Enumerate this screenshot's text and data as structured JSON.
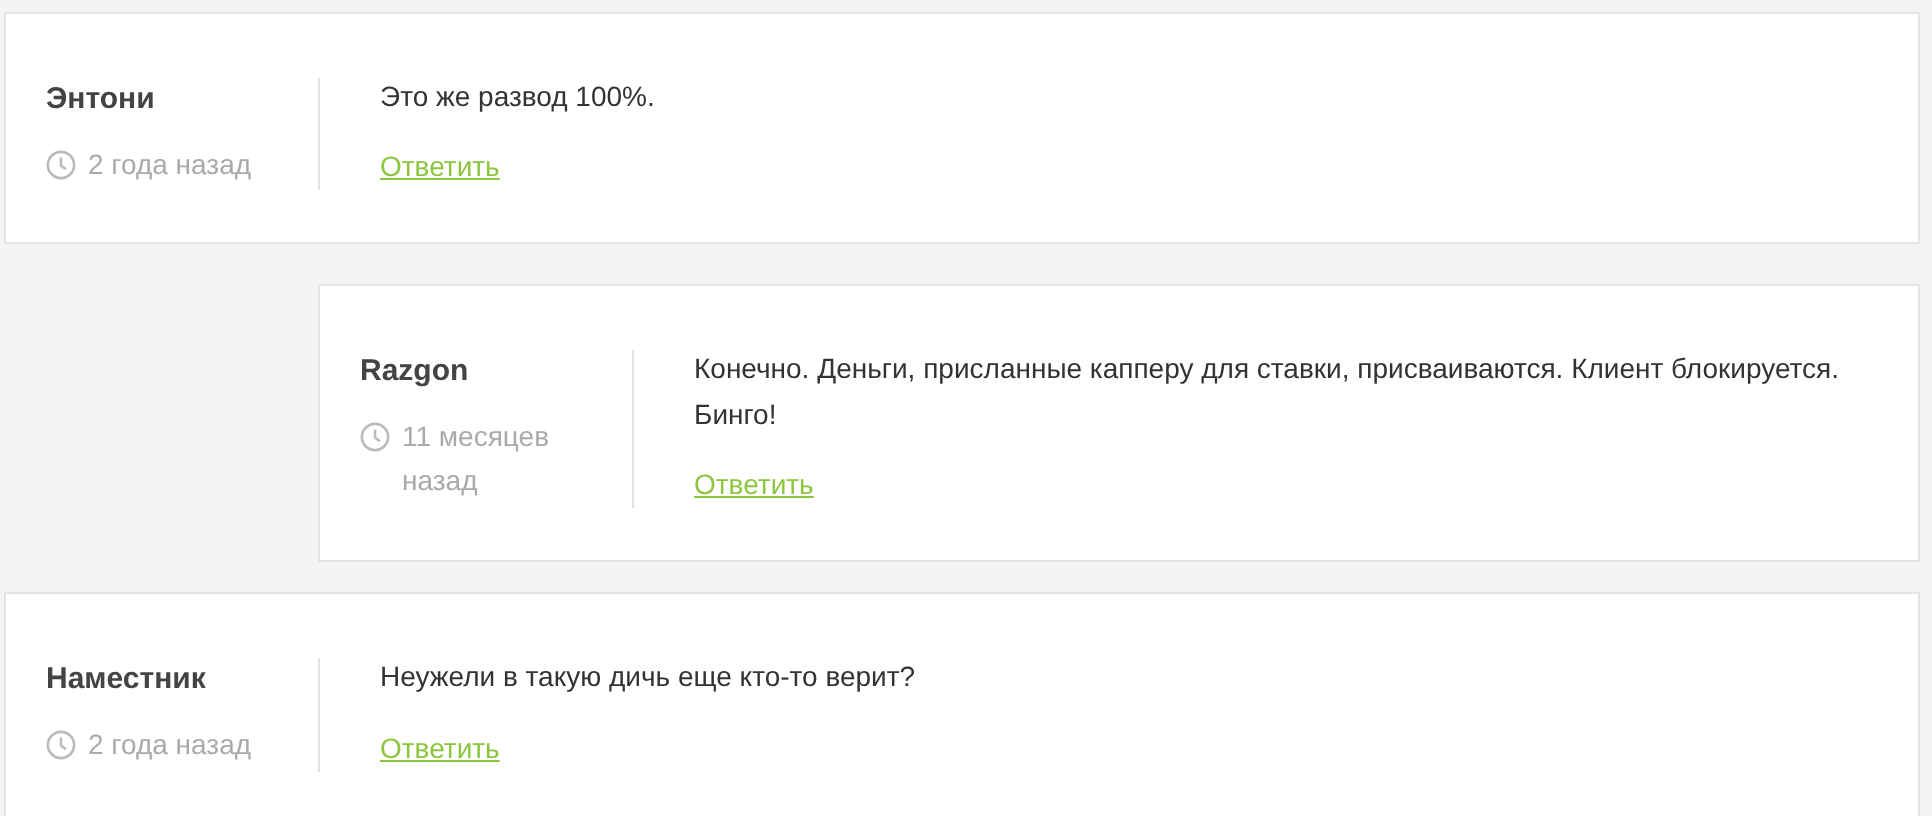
{
  "comments": [
    {
      "author": "Энтони",
      "time": "2 года назад",
      "text": "Это же развод 100%.",
      "reply_label": "Ответить",
      "replies": [
        {
          "author": "Razgon",
          "time": "11 месяцев назад",
          "text": "Конечно. Деньги, присланные капперу для ставки, присваиваются. Клиент блокируется. Бинго!",
          "reply_label": "Ответить"
        }
      ]
    },
    {
      "author": "Наместник",
      "time": "2 года назад",
      "text": "Неужели в такую дичь еще кто-то верит?",
      "reply_label": "Ответить"
    }
  ]
}
